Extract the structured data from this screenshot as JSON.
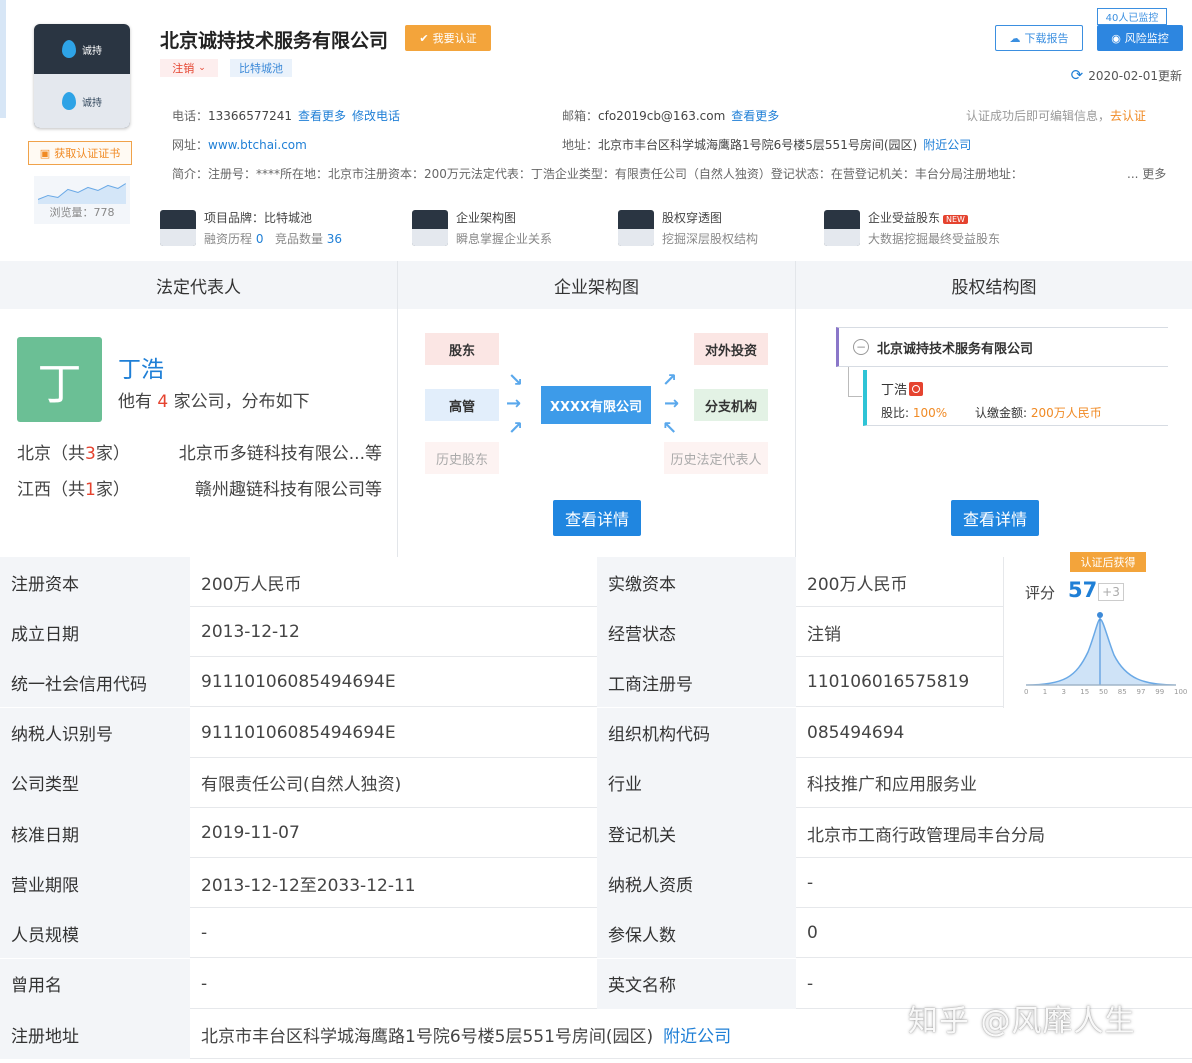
{
  "logo": {
    "brand_text": "诚持",
    "sub_text": "诚持"
  },
  "certificate_button": "获取认证证书",
  "views": "浏览量：778",
  "company": {
    "name": "北京诚持技术服务有限公司",
    "certify_button": "我要认证",
    "status_tag": "注销",
    "brand_tag": "比特城池"
  },
  "actions": {
    "download": "下载报告",
    "monitor": "风险监控",
    "monitor_badge": "40人已监控",
    "updated": "2020-02-01更新"
  },
  "contact": {
    "phone_label": "电话：",
    "phone": "13366577241",
    "phone_more": "查看更多",
    "phone_edit": "修改电话",
    "email_label": "邮箱：",
    "email": "cfo2019cb@163.com",
    "email_more": "查看更多",
    "cert_hint": "认证成功后即可编辑信息，",
    "cert_link": "去认证",
    "website_label": "网址：",
    "website": "www.btchai.com",
    "address_label": "地址：",
    "address": "北京市丰台区科学城海鹰路1号院6号楼5层551号房间(园区)",
    "nearby": "附近公司",
    "intro_label": "简介：",
    "intro": "注册号：****所在地：北京市注册资本：200万元法定代表：丁浩企业类型：有限责任公司（自然人独资）登记状态：在营登记机关：丰台分局注册地址：",
    "intro_more": "... 更多"
  },
  "features": [
    {
      "title": "项目品牌：比特城池",
      "sub_a": "融资历程",
      "sub_a_val": "0",
      "sub_b": "竞品数量",
      "sub_b_val": "36"
    },
    {
      "title": "企业架构图",
      "sub": "瞬息掌握企业关系"
    },
    {
      "title": "股权穿透图",
      "sub": "挖掘深层股权结构"
    },
    {
      "title": "企业受益股东",
      "badge": "NEW",
      "sub": "大数据挖掘最终受益股东"
    }
  ],
  "panels": {
    "legal_rep": {
      "header": "法定代表人",
      "avatar_char": "丁",
      "name": "丁浩",
      "summary_pre": "他有",
      "summary_count": "4",
      "summary_post": "家公司，分布如下",
      "regions": [
        {
          "pre": "北京（共",
          "count": "3",
          "post": "家）",
          "companies": "北京币多链科技有限公...等"
        },
        {
          "pre": "江西（共",
          "count": "1",
          "post": "家）",
          "companies": "赣州趣链科技有限公司等"
        }
      ]
    },
    "structure": {
      "header": "企业架构图",
      "nodes": {
        "shareholder": "股东",
        "executive": "高管",
        "history_shareholder": "历史股东",
        "center": "XXXX有限公司",
        "investment": "对外投资",
        "branch": "分支机构",
        "history_rep": "历史法定代表人"
      },
      "button": "查看详情"
    },
    "equity": {
      "header": "股权结构图",
      "root": "北京诚持技术服务有限公司",
      "holder": "丁浩",
      "ratio_label": "股比:",
      "ratio": "100%",
      "amount_label": "认缴金额:",
      "amount": "200万人民币",
      "button": "查看详情"
    }
  },
  "score": {
    "tag": "认证后获得",
    "label": "评分",
    "value": "57",
    "delta": "+3",
    "axis_ticks": [
      "0",
      "1",
      "3",
      "15",
      "50",
      "85",
      "97",
      "99",
      "100"
    ]
  },
  "table": [
    {
      "l1": "注册资本",
      "v1": "200万人民币",
      "l2": "实缴资本",
      "v2": "200万人民币"
    },
    {
      "l1": "成立日期",
      "v1": "2013-12-12",
      "l2": "经营状态",
      "v2": "注销"
    },
    {
      "l1": "统一社会信用代码",
      "v1": "91110106085494694E",
      "l2": "工商注册号",
      "v2": "110106016575819"
    },
    {
      "l1": "纳税人识别号",
      "v1": "91110106085494694E",
      "l2": "组织机构代码",
      "v2": "085494694"
    },
    {
      "l1": "公司类型",
      "v1": "有限责任公司(自然人独资)",
      "l2": "行业",
      "v2": "科技推广和应用服务业"
    },
    {
      "l1": "核准日期",
      "v1": "2019-11-07",
      "l2": "登记机关",
      "v2": "北京市工商行政管理局丰台分局"
    },
    {
      "l1": "营业期限",
      "v1": "2013-12-12至2033-12-11",
      "l2": "纳税人资质",
      "v2": "-"
    },
    {
      "l1": "人员规模",
      "v1": "-",
      "l2": "参保人数",
      "v2": "0"
    },
    {
      "l1": "曾用名",
      "v1": "-",
      "l2": "英文名称",
      "v2": "-"
    }
  ],
  "address_row": {
    "label": "注册地址",
    "value": "北京市丰台区科学城海鹰路1号院6号楼5层551号房间(园区)",
    "link": "附近公司"
  },
  "watermark": "知乎 @风靡人生"
}
